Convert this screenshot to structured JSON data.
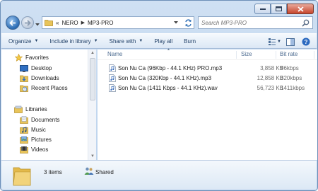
{
  "address": {
    "overflow": "«",
    "crumbs": [
      "NERO",
      "MP3-PRO"
    ]
  },
  "search": {
    "placeholder": "Search MP3-PRO"
  },
  "toolbar": {
    "organize": "Organize",
    "include": "Include in library",
    "share": "Share with",
    "play_all": "Play all",
    "burn": "Burn"
  },
  "nav": {
    "favorites": {
      "label": "Favorites",
      "items": [
        {
          "label": "Desktop",
          "icon": "desktop-icon"
        },
        {
          "label": "Downloads",
          "icon": "downloads-icon"
        },
        {
          "label": "Recent Places",
          "icon": "recent-places-icon"
        }
      ]
    },
    "libraries": {
      "label": "Libraries",
      "items": [
        {
          "label": "Documents",
          "icon": "documents-icon"
        },
        {
          "label": "Music",
          "icon": "music-icon"
        },
        {
          "label": "Pictures",
          "icon": "pictures-icon"
        },
        {
          "label": "Videos",
          "icon": "videos-icon"
        }
      ]
    }
  },
  "columns": {
    "name": "Name",
    "size": "Size",
    "bitrate": "Bit rate"
  },
  "files": [
    {
      "name": "Son Nu Ca (96Kbp - 44.1 KHz) PRO.mp3",
      "size": "3,858 KB",
      "bitrate": "96kbps"
    },
    {
      "name": "Son Nu Ca (320Kbp - 44.1 KHz).mp3",
      "size": "12,858 KB",
      "bitrate": "320kbps"
    },
    {
      "name": "Son Nu Ca (1411 Kbps - 44.1 KHz).wav",
      "size": "56,723 KB",
      "bitrate": "1411kbps"
    }
  ],
  "details": {
    "count": "3 items",
    "state": "Shared"
  },
  "colors": {
    "accent": "#1e3e66",
    "window_frame": "#b9d1ec",
    "folder": "#e8c45a"
  }
}
